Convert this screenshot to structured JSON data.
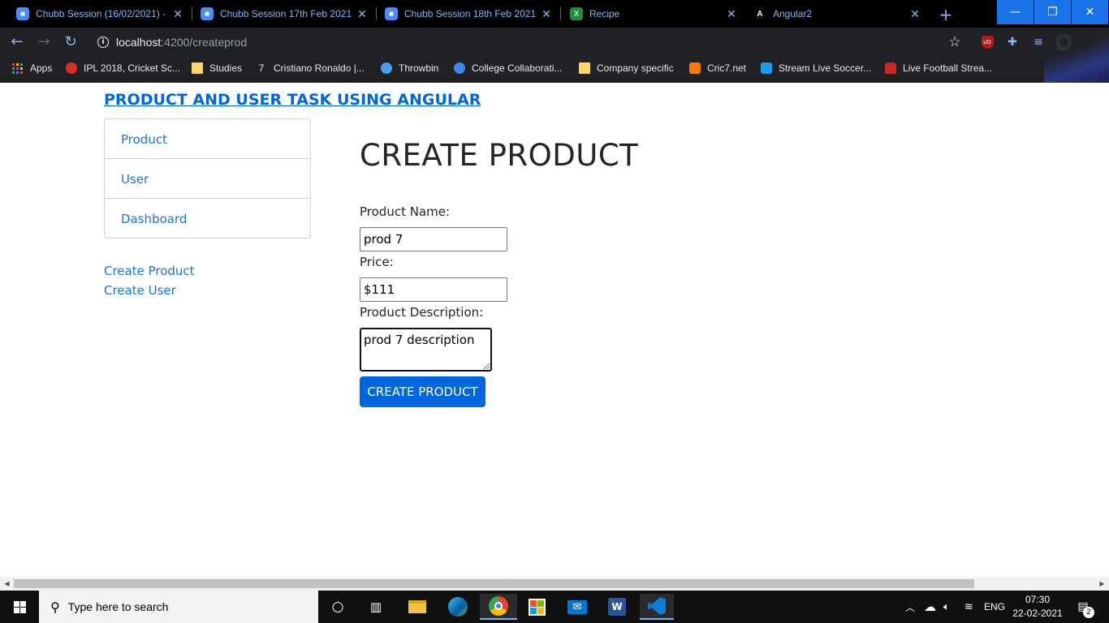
{
  "browser": {
    "tabs": [
      {
        "title": "Chubb Session (16/02/2021) -",
        "favicon": "zoom-icon"
      },
      {
        "title": "Chubb Session 17th Feb 2021",
        "favicon": "zoom-icon"
      },
      {
        "title": "Chubb Session 18th Feb 2021",
        "favicon": "zoom-icon"
      },
      {
        "title": "Recipe",
        "favicon": "spreadsheet-icon"
      },
      {
        "title": "Angular2",
        "favicon": "angular-icon"
      }
    ],
    "active_tab": 4,
    "close_glyph": "✕",
    "new_tab_glyph": "+",
    "url_host": "localhost",
    "url_path": ":4200/createprod",
    "accent": "#8ab4f8",
    "window_accent": "#1a73e8"
  },
  "bookmarks": [
    {
      "label": "Apps",
      "icon": "apps-grid-icon"
    },
    {
      "label": "IPL 2018, Cricket Sc...",
      "icon": "cricket-icon",
      "color": "#d93025"
    },
    {
      "label": "Studies",
      "icon": "folder-icon",
      "color": "#fdd663"
    },
    {
      "label": "Cristiano Ronaldo |...",
      "icon": "ronaldo-icon",
      "color": "#e8eaed"
    },
    {
      "label": "Throwbin",
      "icon": "throwbin-icon",
      "color": "#4a9eea"
    },
    {
      "label": "College Collaborati...",
      "icon": "globe-icon",
      "color": "#4285f4"
    },
    {
      "label": "Company specific",
      "icon": "folder-icon",
      "color": "#fdd663"
    },
    {
      "label": "Cric7.net",
      "icon": "blogger-icon",
      "color": "#f57c00"
    },
    {
      "label": "Stream Live Soccer...",
      "icon": "s2w-icon",
      "color": "#1a9be8"
    },
    {
      "label": "Live Football Strea...",
      "icon": "football-icon",
      "color": "#c62828"
    }
  ],
  "app": {
    "title": "PRODUCT AND USER TASK USING ANGULAR",
    "nav": [
      "Product",
      "User",
      "Dashboard"
    ],
    "links": [
      "Create Product",
      "Create User"
    ],
    "form": {
      "heading": "CREATE PRODUCT",
      "name_label": "Product Name:",
      "name_value": "prod 7",
      "price_label": "Price:",
      "price_value": "$111",
      "desc_label": "Product Description:",
      "desc_value": "prod 7 description",
      "submit_label": "CREATE PRODUCT"
    },
    "link_color": "#1a73d6",
    "primary_color": "#0066dd"
  },
  "taskbar": {
    "search_placeholder": "Type here to search",
    "language": "ENG",
    "time": "07:30",
    "date": "22-02-2021",
    "notification_count": "2"
  }
}
